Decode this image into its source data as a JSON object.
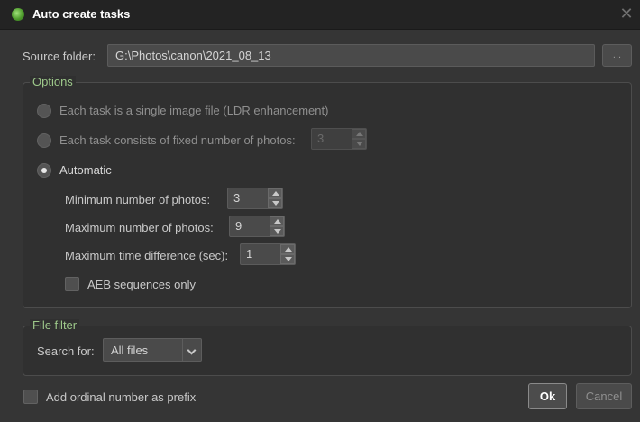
{
  "window": {
    "title": "Auto create tasks",
    "icon": "app-logo-icon",
    "close_glyph": "✕"
  },
  "source": {
    "label": "Source folder:",
    "path": "G:\\Photos\\canon\\2021_08_13",
    "browse_label": "..."
  },
  "options": {
    "title": "Options",
    "radio_single": "Each task is a single image file (LDR enhancement)",
    "radio_fixed": "Each task consists of fixed number of photos:",
    "fixed_value": "3",
    "radio_auto": "Automatic",
    "selected": "automatic",
    "min_label": "Minimum number of photos:",
    "min_value": "3",
    "max_label": "Maximum number of photos:",
    "max_value": "9",
    "time_label": "Maximum time difference (sec):",
    "time_value": "1",
    "aeb_label": "AEB sequences only",
    "aeb_checked": false
  },
  "file_filter": {
    "title": "File filter",
    "search_label": "Search for:",
    "search_value": "All files"
  },
  "footer": {
    "prefix_label": "Add ordinal number as prefix",
    "prefix_checked": false,
    "ok_label": "Ok",
    "cancel_label": "Cancel"
  },
  "colors": {
    "background": "#353535",
    "titlebar": "#232323",
    "group_title": "#9dc88a",
    "text": "#c9c9c9"
  }
}
